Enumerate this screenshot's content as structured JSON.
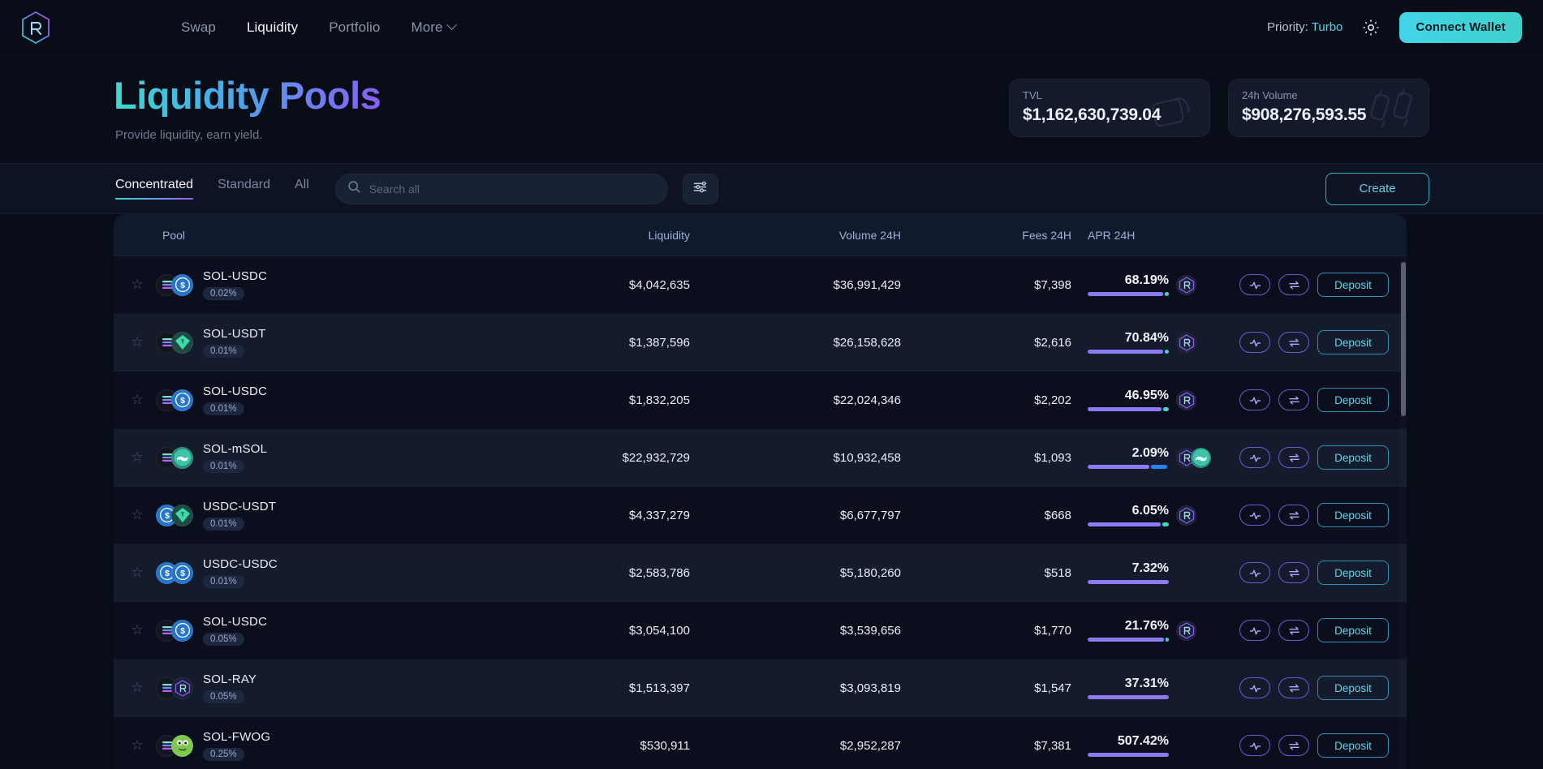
{
  "nav": {
    "logo": "raydium-logo",
    "links": [
      {
        "label": "Swap",
        "active": false
      },
      {
        "label": "Liquidity",
        "active": true
      },
      {
        "label": "Portfolio",
        "active": false
      },
      {
        "label": "More",
        "active": false,
        "has_chevron": true
      }
    ],
    "priority_label": "Priority:",
    "priority_value": "Turbo",
    "settings_icon": "gear-icon",
    "connect_wallet": "Connect Wallet"
  },
  "hero": {
    "title": "Liquidity Pools",
    "subtitle": "Provide liquidity, earn yield.",
    "title_gradient_from": "#3fd8d0",
    "title_gradient_to": "#8a5cf6"
  },
  "stats": [
    {
      "label": "TVL",
      "value": "$1,162,630,739.04",
      "icon": "lock-icon"
    },
    {
      "label": "24h Volume",
      "value": "$908,276,593.55",
      "icon": "candlestick-icon"
    }
  ],
  "toolbar": {
    "tabs": [
      {
        "label": "Concentrated",
        "active": true
      },
      {
        "label": "Standard",
        "active": false
      },
      {
        "label": "All",
        "active": false
      }
    ],
    "search_placeholder": "Search all",
    "search_value": "",
    "search_icon": "search-icon",
    "filter_icon": "sliders-icon",
    "create_label": "Create"
  },
  "table": {
    "columns": [
      "Pool",
      "Liquidity",
      "Volume 24H",
      "Fees 24H",
      "APR 24H"
    ],
    "action_labels": {
      "chart": "chart-icon",
      "swap": "swap-icon",
      "deposit": "Deposit"
    },
    "rows": [
      {
        "favorite": false,
        "pair": "SOL-USDC",
        "fee_tier": "0.02%",
        "token_a": "SOL",
        "token_b": "USDC",
        "liquidity": "$4,042,635",
        "volume_24h": "$36,991,429",
        "fees_24h": "$7,398",
        "apr_24h": "68.19%",
        "apr_bar": [
          {
            "color": "purple",
            "pct": 93
          },
          {
            "color": "teal",
            "pct": 5
          }
        ],
        "rewards": [
          "RAY"
        ],
        "deposit": "Deposit"
      },
      {
        "favorite": false,
        "pair": "SOL-USDT",
        "fee_tier": "0.01%",
        "token_a": "SOL",
        "token_b": "USDT",
        "liquidity": "$1,387,596",
        "volume_24h": "$26,158,628",
        "fees_24h": "$2,616",
        "apr_24h": "70.84%",
        "apr_bar": [
          {
            "color": "purple",
            "pct": 93
          },
          {
            "color": "teal",
            "pct": 5
          }
        ],
        "rewards": [
          "RAY"
        ],
        "deposit": "Deposit"
      },
      {
        "favorite": false,
        "pair": "SOL-USDC",
        "fee_tier": "0.01%",
        "token_a": "SOL",
        "token_b": "USDC",
        "liquidity": "$1,832,205",
        "volume_24h": "$22,024,346",
        "fees_24h": "$2,202",
        "apr_24h": "46.95%",
        "apr_bar": [
          {
            "color": "purple",
            "pct": 91
          },
          {
            "color": "teal",
            "pct": 7
          }
        ],
        "rewards": [
          "RAY"
        ],
        "deposit": "Deposit"
      },
      {
        "favorite": false,
        "pair": "SOL-mSOL",
        "fee_tier": "0.01%",
        "token_a": "SOL",
        "token_b": "mSOL",
        "liquidity": "$22,932,729",
        "volume_24h": "$10,932,458",
        "fees_24h": "$1,093",
        "apr_24h": "2.09%",
        "apr_bar": [
          {
            "color": "purple",
            "pct": 76
          },
          {
            "color": "blue",
            "pct": 20
          }
        ],
        "rewards": [
          "RAY",
          "mSOL"
        ],
        "deposit": "Deposit"
      },
      {
        "favorite": false,
        "pair": "USDC-USDT",
        "fee_tier": "0.01%",
        "token_a": "USDC",
        "token_b": "USDT",
        "liquidity": "$4,337,279",
        "volume_24h": "$6,677,797",
        "fees_24h": "$668",
        "apr_24h": "6.05%",
        "apr_bar": [
          {
            "color": "purple",
            "pct": 90
          },
          {
            "color": "teal",
            "pct": 8
          }
        ],
        "rewards": [
          "RAY"
        ],
        "deposit": "Deposit"
      },
      {
        "favorite": false,
        "pair": "USDC-USDC",
        "fee_tier": "0.01%",
        "token_a": "USDC",
        "token_b": "USDC",
        "liquidity": "$2,583,786",
        "volume_24h": "$5,180,260",
        "fees_24h": "$518",
        "apr_24h": "7.32%",
        "apr_bar": [
          {
            "color": "purple",
            "pct": 100
          }
        ],
        "rewards": [],
        "deposit": "Deposit"
      },
      {
        "favorite": false,
        "pair": "SOL-USDC",
        "fee_tier": "0.05%",
        "token_a": "SOL",
        "token_b": "USDC",
        "liquidity": "$3,054,100",
        "volume_24h": "$3,539,656",
        "fees_24h": "$1,770",
        "apr_24h": "21.76%",
        "apr_bar": [
          {
            "color": "purple",
            "pct": 94
          },
          {
            "color": "teal",
            "pct": 4
          }
        ],
        "rewards": [
          "RAY"
        ],
        "deposit": "Deposit"
      },
      {
        "favorite": false,
        "pair": "SOL-RAY",
        "fee_tier": "0.05%",
        "token_a": "SOL",
        "token_b": "RAY",
        "liquidity": "$1,513,397",
        "volume_24h": "$3,093,819",
        "fees_24h": "$1,547",
        "apr_24h": "37.31%",
        "apr_bar": [
          {
            "color": "purple",
            "pct": 100
          }
        ],
        "rewards": [],
        "deposit": "Deposit"
      },
      {
        "favorite": false,
        "pair": "SOL-FWOG",
        "fee_tier": "0.25%",
        "token_a": "SOL",
        "token_b": "FWOG",
        "liquidity": "$530,911",
        "volume_24h": "$2,952,287",
        "fees_24h": "$7,381",
        "apr_24h": "507.42%",
        "apr_bar": [
          {
            "color": "purple",
            "pct": 100
          }
        ],
        "rewards": [],
        "deposit": "Deposit"
      }
    ]
  }
}
